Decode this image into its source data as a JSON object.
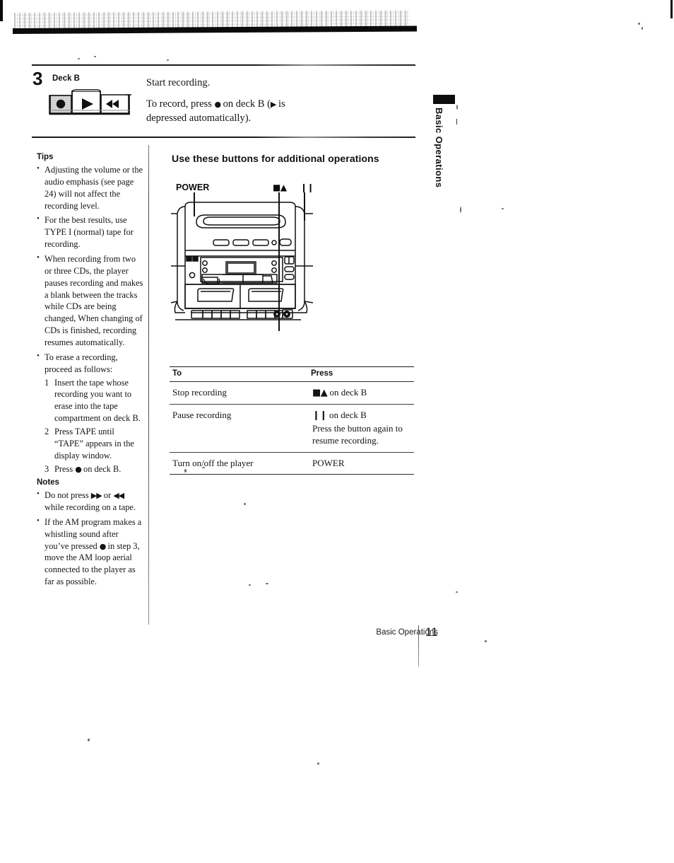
{
  "page": {
    "footer_section": "Basic Operations",
    "page_number": "11",
    "side_tab": "Basic Operations"
  },
  "step": {
    "number": "3",
    "deck_label": "Deck B",
    "line1": "Start recording.",
    "line2_a": "To record, press",
    "line2_record_glyph": "●",
    "line2_b": "on deck B (",
    "line2_play_glyph": "▶",
    "line2_c": "is depressed automatically).",
    "buttons": {
      "record": "●",
      "play": "▶",
      "rewind": "◀◀"
    }
  },
  "tips": {
    "heading": "Tips",
    "items": [
      "Adjusting the volume or the audio emphasis (see page 24) will not affect the recording level.",
      "For the best results, use TYPE I (normal) tape for recording.",
      "When recording from two or three CDs, the player pauses recording and makes a blank between the tracks while CDs are being changed, When changing of CDs is finished, recording resumes automatically."
    ],
    "erase_intro": "To erase a recording, proceed as follows:",
    "erase_steps": [
      {
        "num": "1",
        "text": "Insert the tape whose recording you want to erase into the tape compartment on deck B."
      },
      {
        "num": "2",
        "text": "Press TAPE until “TAPE” appears in the display window."
      },
      {
        "num": "3",
        "text_a": "Press",
        "glyph": "●",
        "text_b": "on deck B."
      }
    ]
  },
  "notes": {
    "heading": "Notes",
    "item1_a": "Do not press",
    "item1_ff": "▶▶",
    "item1_b": "or",
    "item1_rew": "◀◀",
    "item1_c": "while recording on a tape.",
    "item2_a": "If the AM program makes a whistling sound after you’ve pressed",
    "item2_glyph": "●",
    "item2_b": "in step 3, move the AM loop aerial connected to the player as far as possible."
  },
  "additional": {
    "title": "Use these buttons for additional operations",
    "callouts": [
      {
        "name": "power",
        "label": "POWER"
      },
      {
        "name": "stop-eject",
        "label": "■▲"
      },
      {
        "name": "pause",
        "label": "❙❙"
      }
    ],
    "table": {
      "headers": [
        "To",
        "Press"
      ],
      "rows": [
        {
          "to": "Stop recording",
          "press_glyph": "■▲",
          "press_text": "on deck B",
          "press_extra": ""
        },
        {
          "to": "Pause recording",
          "press_glyph": "❙❙",
          "press_text": "on deck B",
          "press_extra": "Press the button again to resume recording."
        },
        {
          "to": "Turn on/off the player",
          "press_glyph": "",
          "press_text": "POWER",
          "press_extra": ""
        }
      ]
    }
  }
}
